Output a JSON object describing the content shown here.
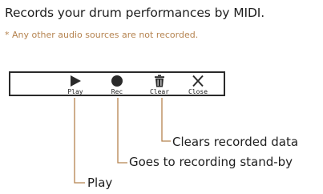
{
  "intro": "Records your drum performances by MIDI.",
  "note": "* Any other audio sources are not recorded.",
  "toolbar": {
    "buttons": [
      {
        "label": "Play",
        "icon": "play-icon"
      },
      {
        "label": "Rec",
        "icon": "record-icon"
      },
      {
        "label": "Clear",
        "icon": "trash-icon"
      },
      {
        "label": "Close",
        "icon": "close-icon"
      }
    ]
  },
  "callouts": {
    "clear": "Clears recorded data",
    "rec": "Goes to recording stand-by",
    "play": "Play"
  },
  "colors": {
    "leader": "#b5834f",
    "note": "#b5834f",
    "text": "#1e1e1e"
  }
}
